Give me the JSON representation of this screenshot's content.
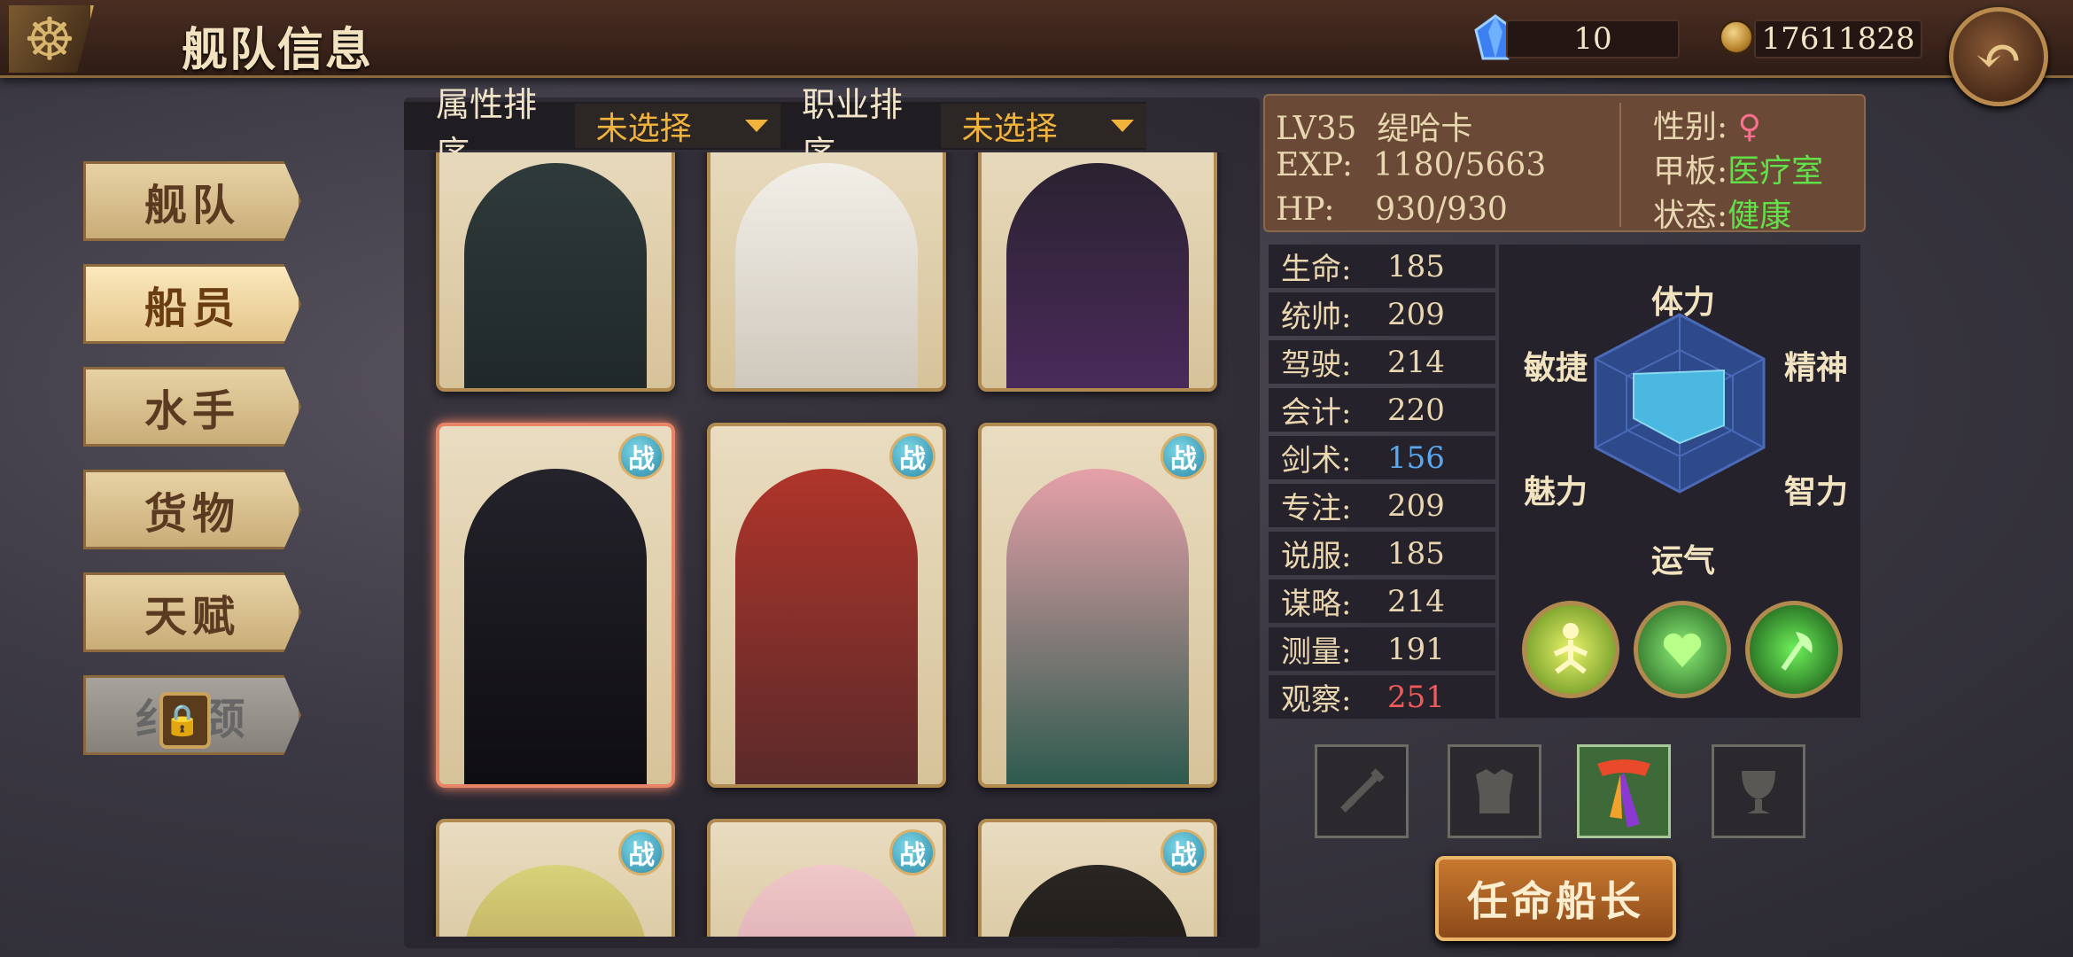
{
  "header": {
    "title": "舰队信息",
    "gems": "10",
    "gold": "17611828"
  },
  "sidebar": [
    {
      "label": "舰队"
    },
    {
      "label": "船员"
    },
    {
      "label": "水手"
    },
    {
      "label": "货物"
    },
    {
      "label": "天赋"
    },
    {
      "label": "纪律",
      "visible_text": "纟 颈"
    }
  ],
  "sort": {
    "attr_label": "属性排序",
    "attr_value": "未选择",
    "job_label": "职业排序",
    "job_value": "未选择"
  },
  "battle_badge": "战",
  "crew": {
    "level": "LV35",
    "name": "缇哈卡",
    "exp_label": "EXP:",
    "exp": "1180/5663",
    "hp_label": "HP:",
    "hp": "930/930",
    "gender_label": "性别:",
    "gender": "♀",
    "deck_label": "甲板:",
    "deck": "医疗室",
    "status_label": "状态:",
    "status": "健康"
  },
  "stats": [
    {
      "k": "生命:",
      "v": "185",
      "color": "#ead7b0"
    },
    {
      "k": "统帅:",
      "v": "209",
      "color": "#ead7b0"
    },
    {
      "k": "驾驶:",
      "v": "214",
      "color": "#ead7b0"
    },
    {
      "k": "会计:",
      "v": "220",
      "color": "#ead7b0"
    },
    {
      "k": "剑术:",
      "v": "156",
      "color": "#5aa8f0"
    },
    {
      "k": "专注:",
      "v": "209",
      "color": "#ead7b0"
    },
    {
      "k": "说服:",
      "v": "185",
      "color": "#ead7b0"
    },
    {
      "k": "谋略:",
      "v": "214",
      "color": "#ead7b0"
    },
    {
      "k": "测量:",
      "v": "191",
      "color": "#ead7b0"
    },
    {
      "k": "观察:",
      "v": "251",
      "color": "#f05a5a"
    }
  ],
  "radar": {
    "top": "体力",
    "tr": "精神",
    "br": "智力",
    "bottom": "运气",
    "bl": "魅力",
    "tl": "敏捷"
  },
  "appoint_label": "任命船长"
}
